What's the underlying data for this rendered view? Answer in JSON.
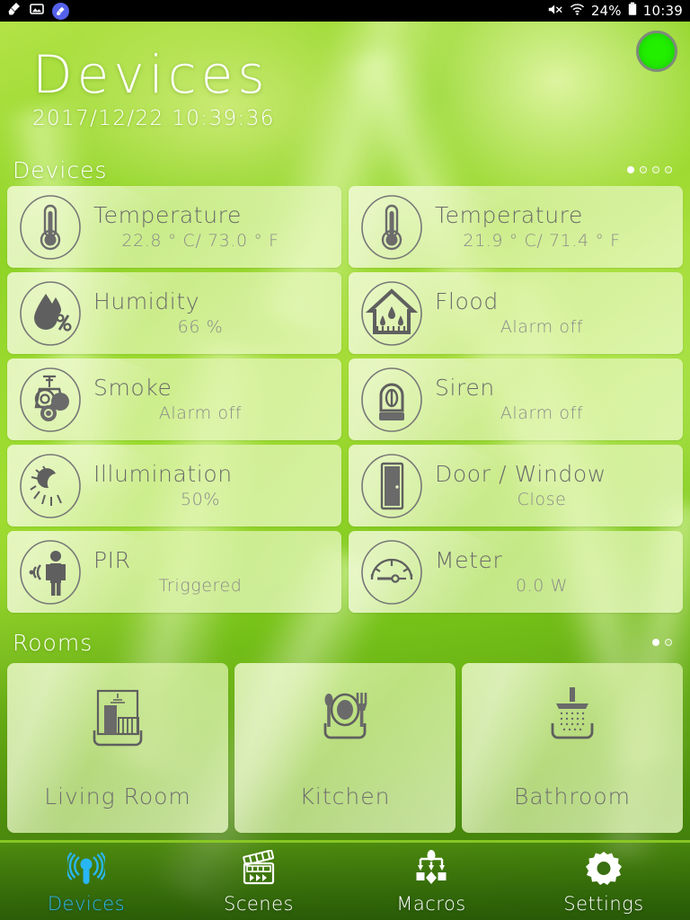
{
  "statusbar": {
    "left_icons": [
      "brush-icon",
      "screenshot-icon",
      "brush-badge-icon"
    ],
    "mute_icon": "mute-icon",
    "wifi_icon": "wifi-icon",
    "battery_percent": "24%",
    "battery_icon": "battery-icon",
    "clock": "10:39"
  },
  "header": {
    "title": "Devices",
    "datetime": "2017/12/22 10:39:36",
    "status_indicator": {
      "name": "connection-status",
      "color": "#22ee00",
      "state": "online"
    }
  },
  "devices_section": {
    "label": "Devices",
    "pages": 4,
    "active_page": 1,
    "cards": [
      {
        "icon": "thermometer-icon",
        "title": "Temperature",
        "value": "22.8 ° C/ 73.0 ° F"
      },
      {
        "icon": "thermometer-icon",
        "title": "Temperature",
        "value": "21.9 ° C/ 71.4 ° F"
      },
      {
        "icon": "humidity-icon",
        "title": "Humidity",
        "value": "66 %"
      },
      {
        "icon": "flood-icon",
        "title": "Flood",
        "value": "Alarm off"
      },
      {
        "icon": "smoke-icon",
        "title": "Smoke",
        "value": "Alarm off"
      },
      {
        "icon": "siren-icon",
        "title": "Siren",
        "value": "Alarm off"
      },
      {
        "icon": "illumination-icon",
        "title": "Illumination",
        "value": "50%"
      },
      {
        "icon": "door-window-icon",
        "title": "Door / Window",
        "value": "Close"
      },
      {
        "icon": "pir-motion-icon",
        "title": "PIR",
        "value": "Triggered"
      },
      {
        "icon": "meter-icon",
        "title": "Meter",
        "value": "0.0 W"
      }
    ]
  },
  "rooms_section": {
    "label": "Rooms",
    "pages": 2,
    "active_page": 1,
    "rooms": [
      {
        "icon": "living-room-icon",
        "label": "Living Room"
      },
      {
        "icon": "kitchen-icon",
        "label": "Kitchen"
      },
      {
        "icon": "bathroom-icon",
        "label": "Bathroom"
      }
    ]
  },
  "navbar": {
    "active_color": "#29b6f6",
    "items": [
      {
        "icon": "devices-signal-icon",
        "label": "Devices",
        "active": true
      },
      {
        "icon": "clapperboard-icon",
        "label": "Scenes",
        "active": false
      },
      {
        "icon": "macros-flow-icon",
        "label": "Macros",
        "active": false
      },
      {
        "icon": "gear-icon",
        "label": "Settings",
        "active": false
      }
    ]
  }
}
